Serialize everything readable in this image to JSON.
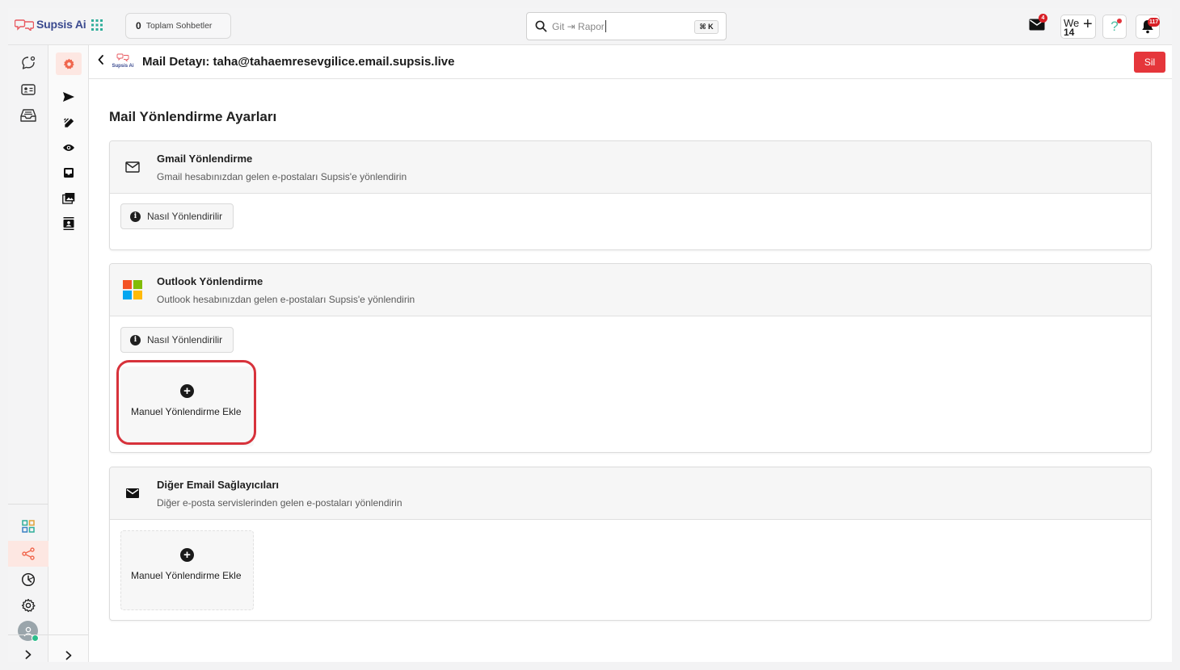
{
  "app": {
    "brand": "Supsis Ai",
    "header_logo_text": "Supsis Ai"
  },
  "topbar": {
    "chat_count": "0",
    "chat_label": "Toplam Sohbetler",
    "search_placeholder": "Git ⇥ Rapor",
    "search_shortcut": "⌘ K",
    "mail_badge": "4",
    "workspace_label": "We",
    "workspace_number": "14",
    "workspace_add": "+",
    "help_label": "?",
    "notification_badge": "117"
  },
  "header": {
    "title": "Mail Detayı: taha@tahaemresevgilice.email.supsis.live",
    "delete_label": "Sil"
  },
  "page": {
    "title": "Mail Yönlendirme Ayarları"
  },
  "cards": [
    {
      "title": "Gmail Yönlendirme",
      "subtitle": "Gmail hesabınızdan gelen e-postaları Supsis'e yönlendirin",
      "how_label": "Nasıl Yönlendirilir"
    },
    {
      "title": "Outlook Yönlendirme",
      "subtitle": "Outlook hesabınızdan gelen e-postaları Supsis'e yönlendirin",
      "how_label": "Nasıl Yönlendirilir",
      "add_label": "Manuel Yönlendirme Ekle"
    },
    {
      "title": "Diğer Email Sağlayıcıları",
      "subtitle": "Diğer e-posta servislerinden gelen e-postaları yönlendirin",
      "add_label": "Manuel Yönlendirme Ekle"
    }
  ],
  "icons": {
    "primary_rail": [
      "chat-bubble-icon",
      "contact-card-icon",
      "inbox-tray-icon",
      "dashboard-grid-icon",
      "share-icon",
      "chart-clock-icon",
      "settings-gear-icon",
      "avatar",
      "expand-chevron-icon"
    ],
    "secondary_rail": [
      "gear-icon",
      "send-icon",
      "edit-icon",
      "eye-icon",
      "inbox-icon",
      "gallery-icon",
      "contacts-icon",
      "expand-chevron-icon"
    ]
  },
  "colors": {
    "accent_red": "#e5363b",
    "brand_blue": "#3b4a8f",
    "selected_rail_bg": "#fde7e2",
    "selected_rail_icon": "#f0674e",
    "online": "#2bbd8b"
  }
}
